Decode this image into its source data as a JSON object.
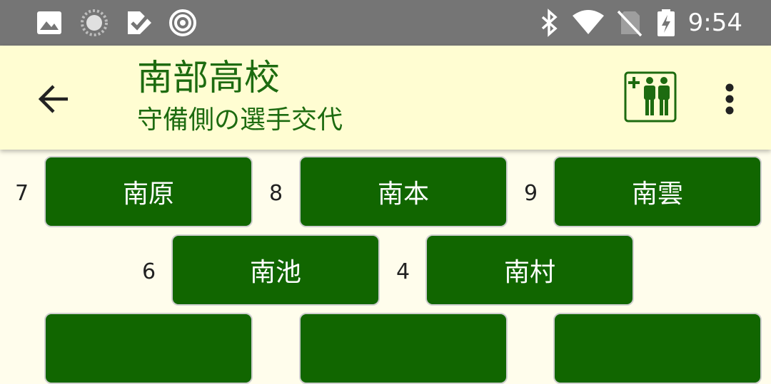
{
  "status_bar": {
    "time": "9:54",
    "icons": [
      "image-icon",
      "loading-icon",
      "checklist-icon",
      "target-icon",
      "bluetooth-icon",
      "wifi-icon",
      "no-sim-icon",
      "battery-charging-icon"
    ]
  },
  "app_bar": {
    "title": "南部高校",
    "subtitle": "守備側の選手交代",
    "back_icon": "arrow-left-icon",
    "substitute_icon": "add-players-icon",
    "menu_icon": "more-vert-icon"
  },
  "colors": {
    "status_bar": "#757575",
    "app_bar": "#fffdd2",
    "background": "#fffdec",
    "accent_green": "#116600",
    "title_green": "#1d6b10"
  },
  "field": {
    "row1": [
      {
        "position": "7",
        "name": "南原"
      },
      {
        "position": "8",
        "name": "南本"
      },
      {
        "position": "9",
        "name": "南雲"
      }
    ],
    "row2": [
      {
        "position": "6",
        "name": "南池"
      },
      {
        "position": "4",
        "name": "南村"
      }
    ]
  }
}
